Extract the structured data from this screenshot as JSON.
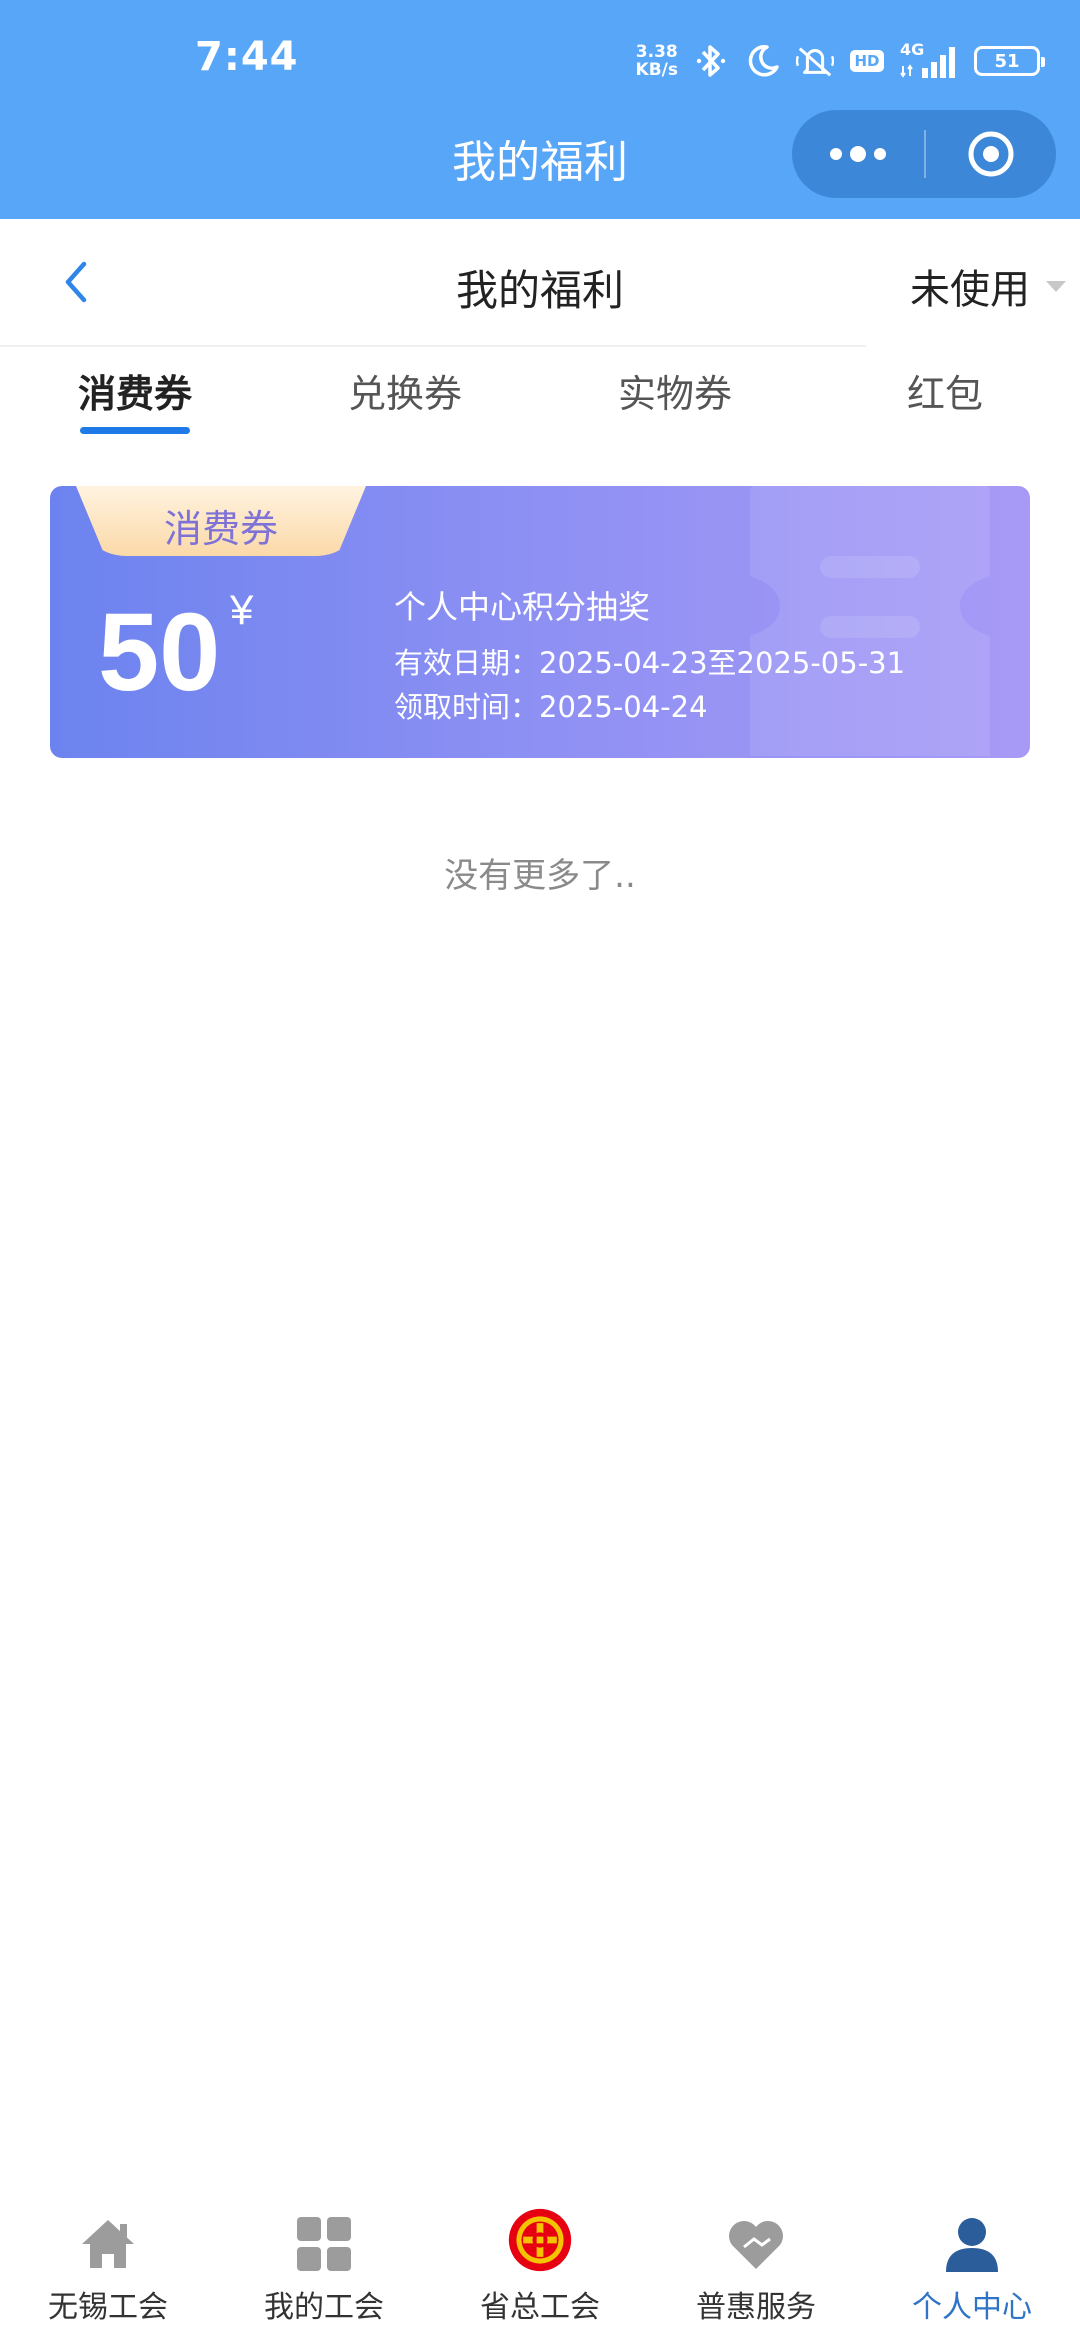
{
  "status_bar": {
    "time": "7:44",
    "net_speed_value": "3.38",
    "net_speed_unit": "KB/s",
    "hd_label": "HD",
    "network_label": "4G",
    "battery": "51",
    "icons": [
      "bluetooth-icon",
      "moon-icon",
      "mute-icon",
      "hd-icon",
      "signal-icon",
      "battery-icon"
    ]
  },
  "mini_program": {
    "title": "我的福利"
  },
  "page_nav": {
    "title": "我的福利",
    "status_filter": "未使用"
  },
  "tabs": [
    {
      "label": "消费券",
      "active": true
    },
    {
      "label": "兑换券",
      "active": false
    },
    {
      "label": "实物券",
      "active": false
    },
    {
      "label": "红包",
      "active": false
    }
  ],
  "coupon": {
    "tag": "消费券",
    "amount": "50",
    "currency": "¥",
    "name": "个人中心积分抽奖",
    "valid_period": "有效日期：2025-04-23至2025-05-31",
    "received_time": "领取时间：2025-04-24"
  },
  "end_hint": "没有更多了..",
  "bottom_nav": [
    {
      "label": "无锡工会",
      "icon": "home-icon"
    },
    {
      "label": "我的工会",
      "icon": "grid-icon"
    },
    {
      "label": "省总工会",
      "icon": "union-emblem-icon"
    },
    {
      "label": "普惠服务",
      "icon": "heart-icon"
    },
    {
      "label": "个人中心",
      "icon": "person-icon",
      "active": true
    }
  ],
  "colors": {
    "header_bg": "#58a6f8",
    "accent_blue": "#1e7ae6",
    "active_tab_text": "#2f74c7",
    "coupon_gradient_start": "#6c83ef",
    "coupon_gradient_end": "#a79af6",
    "coupon_tag_text": "#7e72d6"
  }
}
